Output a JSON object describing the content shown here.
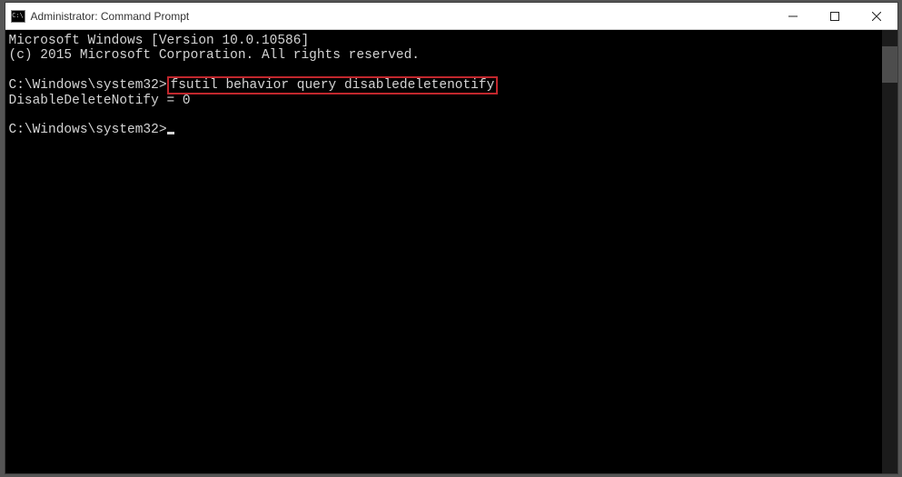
{
  "titlebar": {
    "title": "Administrator: Command Prompt",
    "icon_label": "C:\\"
  },
  "controls": {
    "minimize": "Minimize",
    "maximize": "Maximize",
    "close": "Close"
  },
  "terminal": {
    "line1": "Microsoft Windows [Version 10.0.10586]",
    "line2": "(c) 2015 Microsoft Corporation. All rights reserved.",
    "blank1": "",
    "prompt1": "C:\\Windows\\system32>",
    "command1": "fsutil behavior query disabledeletenotify",
    "output1": "DisableDeleteNotify = 0",
    "blank2": "",
    "prompt2": "C:\\Windows\\system32>"
  }
}
